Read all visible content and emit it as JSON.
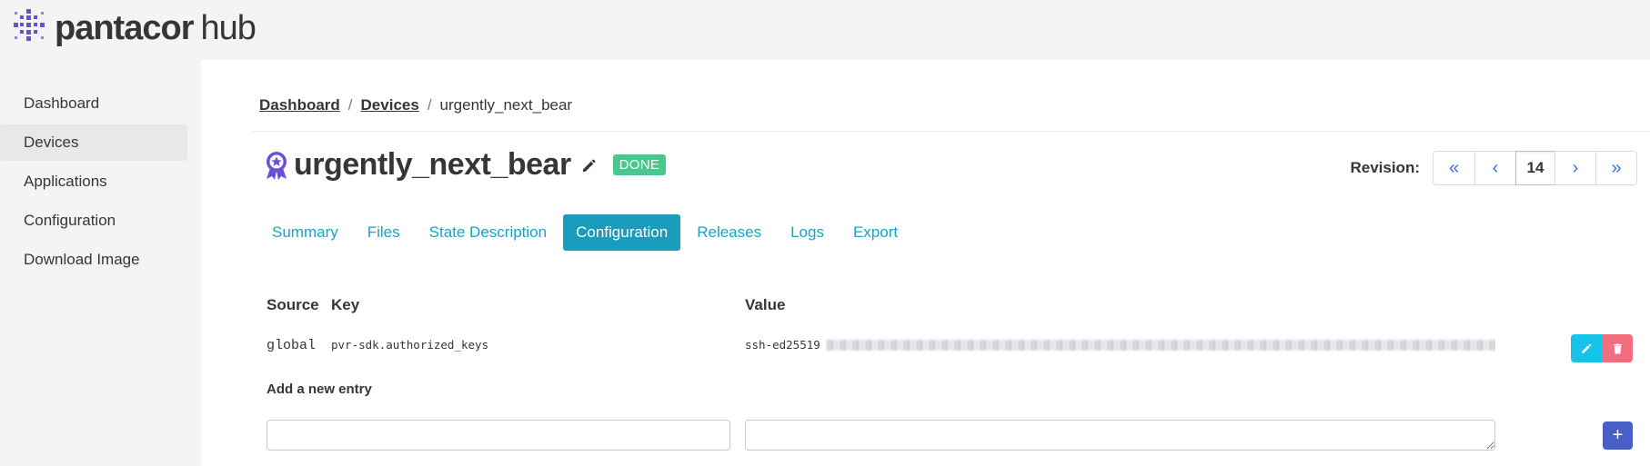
{
  "app": {
    "logo_brand": "pantacor",
    "logo_sub": "hub",
    "brand_color": "#6a4fd8"
  },
  "sidebar": {
    "items": [
      {
        "label": "Dashboard",
        "active": false
      },
      {
        "label": "Devices",
        "active": true
      },
      {
        "label": "Applications",
        "active": false
      },
      {
        "label": "Configuration",
        "active": false
      },
      {
        "label": "Download Image",
        "active": false
      }
    ]
  },
  "breadcrumb": {
    "items": [
      "Dashboard",
      "Devices"
    ],
    "current": "urgently_next_bear",
    "separator": "/"
  },
  "device": {
    "name": "urgently_next_bear",
    "status": "DONE",
    "status_color": "#48c78e",
    "icon": "award-badge-icon"
  },
  "revision": {
    "label": "Revision:",
    "value": "14",
    "first_symbol": "«",
    "prev_symbol": "‹",
    "next_symbol": "›",
    "last_symbol": "»"
  },
  "tabs": [
    {
      "label": "Summary",
      "active": false
    },
    {
      "label": "Files",
      "active": false
    },
    {
      "label": "State Description",
      "active": false
    },
    {
      "label": "Configuration",
      "active": true
    },
    {
      "label": "Releases",
      "active": false
    },
    {
      "label": "Logs",
      "active": false
    },
    {
      "label": "Export",
      "active": false
    }
  ],
  "config_table": {
    "headers": {
      "source": "Source",
      "key": "Key",
      "value": "Value"
    },
    "rows": [
      {
        "source": "global",
        "key": "pvr-sdk.authorized_keys",
        "value_prefix": "ssh-ed25519"
      }
    ]
  },
  "add_entry": {
    "label": "Add a new entry",
    "add_symbol": "+"
  },
  "colors": {
    "tab_text": "#1ba3c7",
    "tab_active_bg": "#1a9cbd",
    "edit_button": "#17c4e9",
    "delete_button": "#f26e7f",
    "add_button": "#485fc7",
    "pager_text": "#3273dc"
  }
}
